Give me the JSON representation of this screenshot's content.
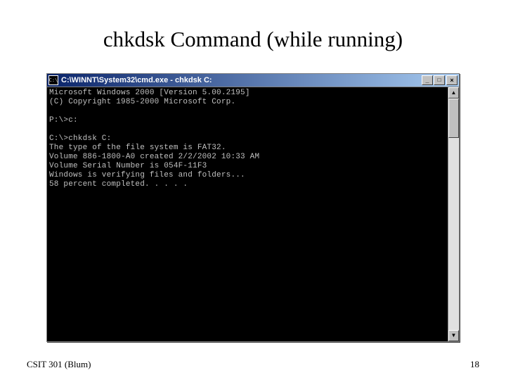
{
  "slide": {
    "title": "chkdsk Command (while running)",
    "footer_left": "CSIT 301 (Blum)",
    "footer_right": "18"
  },
  "cmd": {
    "icon_text": "C:\\",
    "title": "C:\\WINNT\\System32\\cmd.exe - chkdsk C:",
    "buttons": {
      "minimize": "_",
      "maximize": "□",
      "close": "×"
    },
    "scroll": {
      "up": "▲",
      "down": "▼"
    },
    "lines": [
      "Microsoft Windows 2000 [Version 5.00.2195]",
      "(C) Copyright 1985-2000 Microsoft Corp.",
      "",
      "P:\\>c:",
      "",
      "C:\\>chkdsk C:",
      "The type of the file system is FAT32.",
      "Volume 886-1800-A0 created 2/2/2002 10:33 AM",
      "Volume Serial Number is 054F-11F3",
      "Windows is verifying files and folders...",
      "58 percent completed. . . . ."
    ]
  }
}
